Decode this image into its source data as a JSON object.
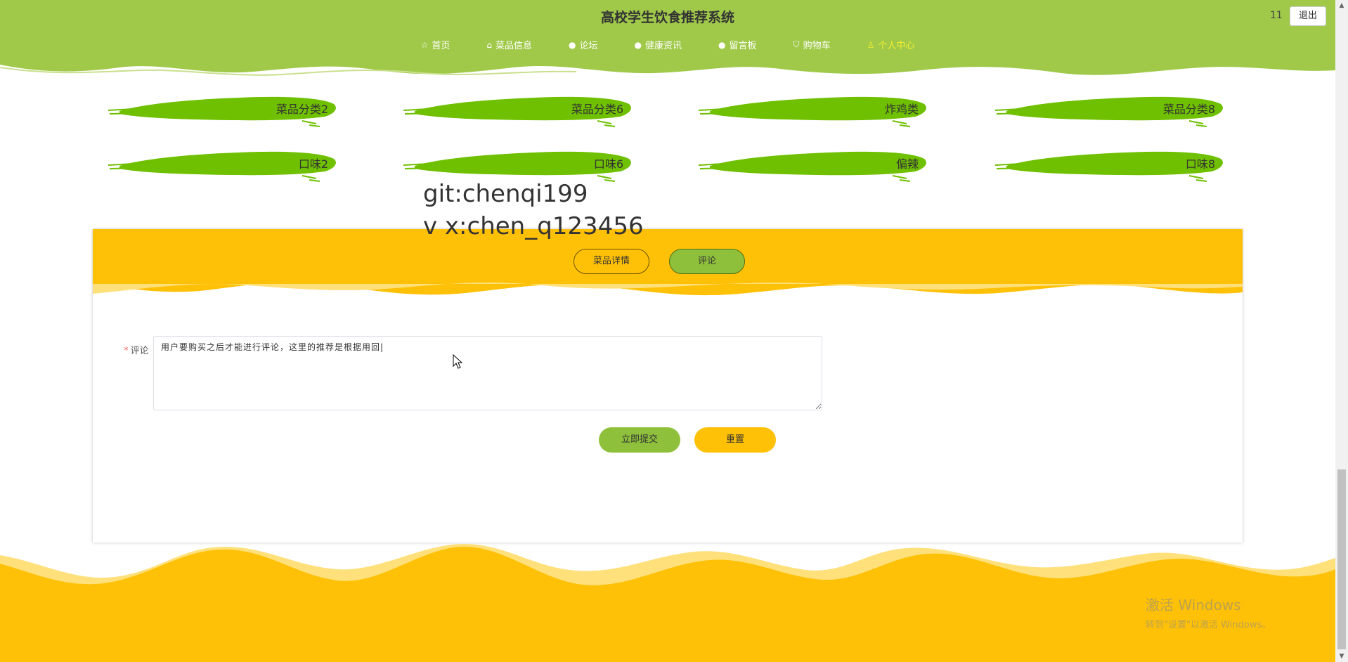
{
  "header": {
    "title": "高校学生饮食推荐系统",
    "user": "11",
    "logout": "退出",
    "bg_color": "#a0c94a"
  },
  "nav": [
    {
      "icon": "star-icon",
      "label": "首页"
    },
    {
      "icon": "bag-icon",
      "label": "菜品信息"
    },
    {
      "icon": "circle-icon",
      "label": "论坛"
    },
    {
      "icon": "circle-icon",
      "label": "健康资讯"
    },
    {
      "icon": "info-icon",
      "label": "留言板"
    },
    {
      "icon": "cart-icon",
      "label": "购物车"
    },
    {
      "icon": "user-icon",
      "label": "个人中心"
    }
  ],
  "tags": {
    "row1": [
      "菜品分类2",
      "菜品分类6",
      "炸鸡类",
      "菜品分类8"
    ],
    "row2": [
      "口味2",
      "口味6",
      "偏辣",
      "口味8"
    ]
  },
  "watermark": {
    "line1": "git:chenqi199",
    "line2": "v x:chen_q123456"
  },
  "tabs": {
    "detail": "菜品详情",
    "comment": "评论"
  },
  "form": {
    "required_mark": "*",
    "label": "评论",
    "value": "用户要购买之后才能进行评论，这里的推荐是根据用回|",
    "submit": "立即提交",
    "reset": "重置"
  },
  "windows": {
    "title": "激活 Windows",
    "sub": "转到\"设置\"以激活 Windows。"
  },
  "colors": {
    "green": "#8ec03c",
    "yellow": "#ffc107",
    "light_yellow": "#ffe07a"
  }
}
